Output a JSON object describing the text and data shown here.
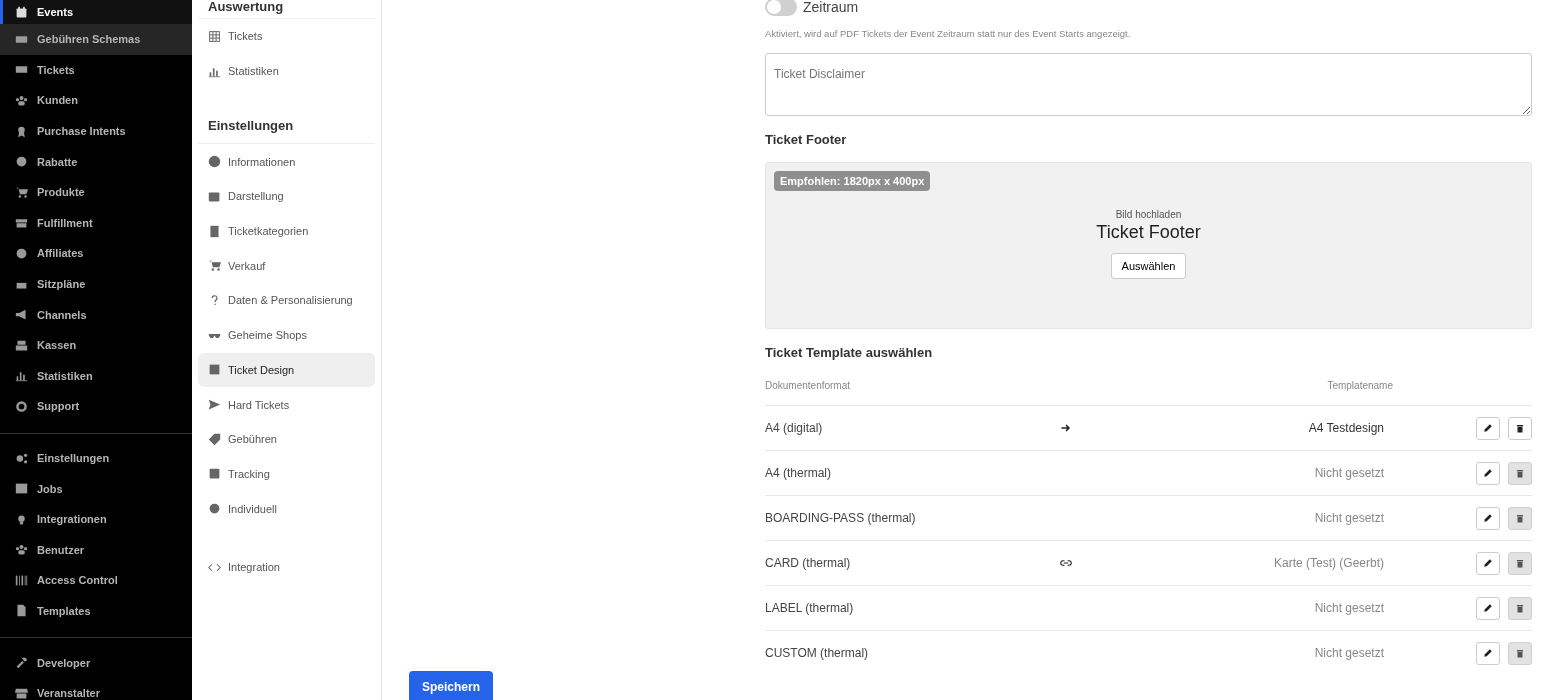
{
  "sidebar": {
    "groups": [
      {
        "items": [
          {
            "label": "Events",
            "selected": true,
            "highlighted": false
          },
          {
            "label": "Gebühren Schemas",
            "selected": false,
            "highlighted": true
          },
          {
            "label": "Tickets",
            "selected": false,
            "highlighted": false
          },
          {
            "label": "Kunden",
            "selected": false,
            "highlighted": false
          },
          {
            "label": "Purchase Intents",
            "selected": false,
            "highlighted": false
          },
          {
            "label": "Rabatte",
            "selected": false,
            "highlighted": false
          },
          {
            "label": "Produkte",
            "selected": false,
            "highlighted": false
          },
          {
            "label": "Fulfillment",
            "selected": false,
            "highlighted": false
          },
          {
            "label": "Affiliates",
            "selected": false,
            "highlighted": false
          },
          {
            "label": "Sitzpläne",
            "selected": false,
            "highlighted": false
          },
          {
            "label": "Channels",
            "selected": false,
            "highlighted": false
          },
          {
            "label": "Kassen",
            "selected": false,
            "highlighted": false
          },
          {
            "label": "Statistiken",
            "selected": false,
            "highlighted": false
          },
          {
            "label": "Support",
            "selected": false,
            "highlighted": false
          }
        ]
      },
      {
        "items": [
          {
            "label": "Einstellungen",
            "selected": false,
            "highlighted": false
          },
          {
            "label": "Jobs",
            "selected": false,
            "highlighted": false
          },
          {
            "label": "Integrationen",
            "selected": false,
            "highlighted": false
          },
          {
            "label": "Benutzer",
            "selected": false,
            "highlighted": false
          },
          {
            "label": "Access Control",
            "selected": false,
            "highlighted": false
          },
          {
            "label": "Templates",
            "selected": false,
            "highlighted": false
          }
        ]
      },
      {
        "items": [
          {
            "label": "Developer",
            "selected": false,
            "highlighted": false
          },
          {
            "label": "Veranstalter",
            "selected": false,
            "highlighted": false
          }
        ]
      }
    ]
  },
  "event_nav": {
    "sections": [
      {
        "title": "Auswertung",
        "items": [
          {
            "label": "Tickets",
            "selected": false
          },
          {
            "label": "Statistiken",
            "selected": false
          }
        ]
      },
      {
        "title": "Einstellungen",
        "items": [
          {
            "label": "Informationen",
            "selected": false
          },
          {
            "label": "Darstellung",
            "selected": false
          },
          {
            "label": "Ticketkategorien",
            "selected": false
          },
          {
            "label": "Verkauf",
            "selected": false
          },
          {
            "label": "Daten & Personalisierung",
            "selected": false
          },
          {
            "label": "Geheime Shops",
            "selected": false
          },
          {
            "label": "Ticket Design",
            "selected": true
          },
          {
            "label": "Hard Tickets",
            "selected": false
          },
          {
            "label": "Gebühren",
            "selected": false
          },
          {
            "label": "Tracking",
            "selected": false
          },
          {
            "label": "Individuell",
            "selected": false
          }
        ]
      },
      {
        "items": [
          {
            "label": "Integration",
            "selected": false
          }
        ]
      }
    ]
  },
  "form": {
    "toggle": {
      "label": "Zeitraum",
      "on": false,
      "help": "Aktiviert, wird auf PDF Tickets der Event Zeitraum statt nur des Event Starts angezeigt."
    },
    "disclaimer": {
      "placeholder": "Ticket Disclaimer"
    },
    "footer": {
      "heading": "Ticket Footer",
      "badge": "Empfohlen: 1820px x 400px",
      "caption": "Bild hochladen",
      "title": "Ticket Footer",
      "button": "Auswählen"
    },
    "templates": {
      "heading": "Ticket Template auswählen",
      "columns": [
        "Dokumentenformat",
        "Templatename"
      ],
      "rows": [
        {
          "format": "A4 (digital)",
          "kind": "arrow",
          "template": "A4 Testdesign",
          "set": true,
          "delete_disabled": false
        },
        {
          "format": "A4 (thermal)",
          "kind": "none",
          "template": "Nicht gesetzt",
          "set": false,
          "delete_disabled": true
        },
        {
          "format": "BOARDING-PASS (thermal)",
          "kind": "none",
          "template": "Nicht gesetzt",
          "set": false,
          "delete_disabled": true
        },
        {
          "format": "CARD (thermal)",
          "kind": "link",
          "template": "Karte (Test) (Geerbt)",
          "set": false,
          "delete_disabled": true
        },
        {
          "format": "LABEL (thermal)",
          "kind": "none",
          "template": "Nicht gesetzt",
          "set": false,
          "delete_disabled": true
        },
        {
          "format": "CUSTOM (thermal)",
          "kind": "none",
          "template": "Nicht gesetzt",
          "set": false,
          "delete_disabled": true
        }
      ]
    }
  },
  "save_button": "Speichern"
}
